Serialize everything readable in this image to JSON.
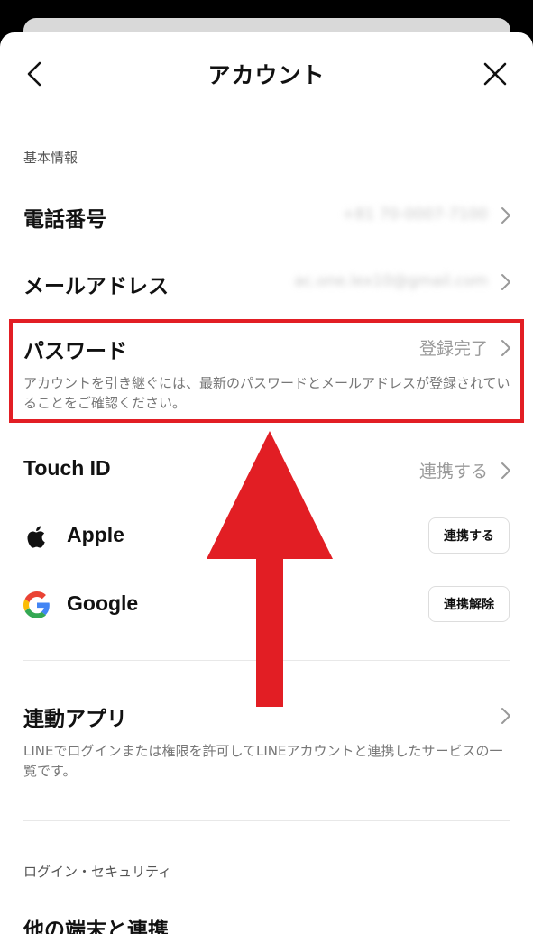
{
  "header": {
    "title": "アカウント"
  },
  "basic_info": {
    "section_label": "基本情報",
    "phone": {
      "label": "電話番号",
      "value": "+81 70-0007-7100"
    },
    "email": {
      "label": "メールアドレス",
      "value": "ac.one.lex10@gmail.com"
    },
    "password": {
      "label": "パスワード",
      "value": "登録完了",
      "description": "アカウントを引き継ぐには、最新のパスワードとメールアドレスが登録されていることをご確認ください。"
    },
    "touch_id": {
      "label": "Touch ID",
      "value": "連携する"
    },
    "apple": {
      "label": "Apple",
      "button": "連携する"
    },
    "google": {
      "label": "Google",
      "button": "連携解除"
    }
  },
  "linked_apps": {
    "label": "連動アプリ",
    "description": "LINEでログインまたは権限を許可してLINEアカウントと連携したサービスの一覧です。"
  },
  "login_security": {
    "section_label": "ログイン・セキュリティ",
    "next_item_label": "他の端末と連携"
  },
  "colors": {
    "highlight": "#e21e24",
    "text": "#111111",
    "muted": "#9a9a9a"
  },
  "icons": {
    "back": "chevron-left-icon",
    "close": "close-icon",
    "row_chevron": "chevron-right-icon",
    "apple": "apple-logo-icon",
    "google": "google-logo-icon",
    "annotation": "red-up-arrow"
  }
}
